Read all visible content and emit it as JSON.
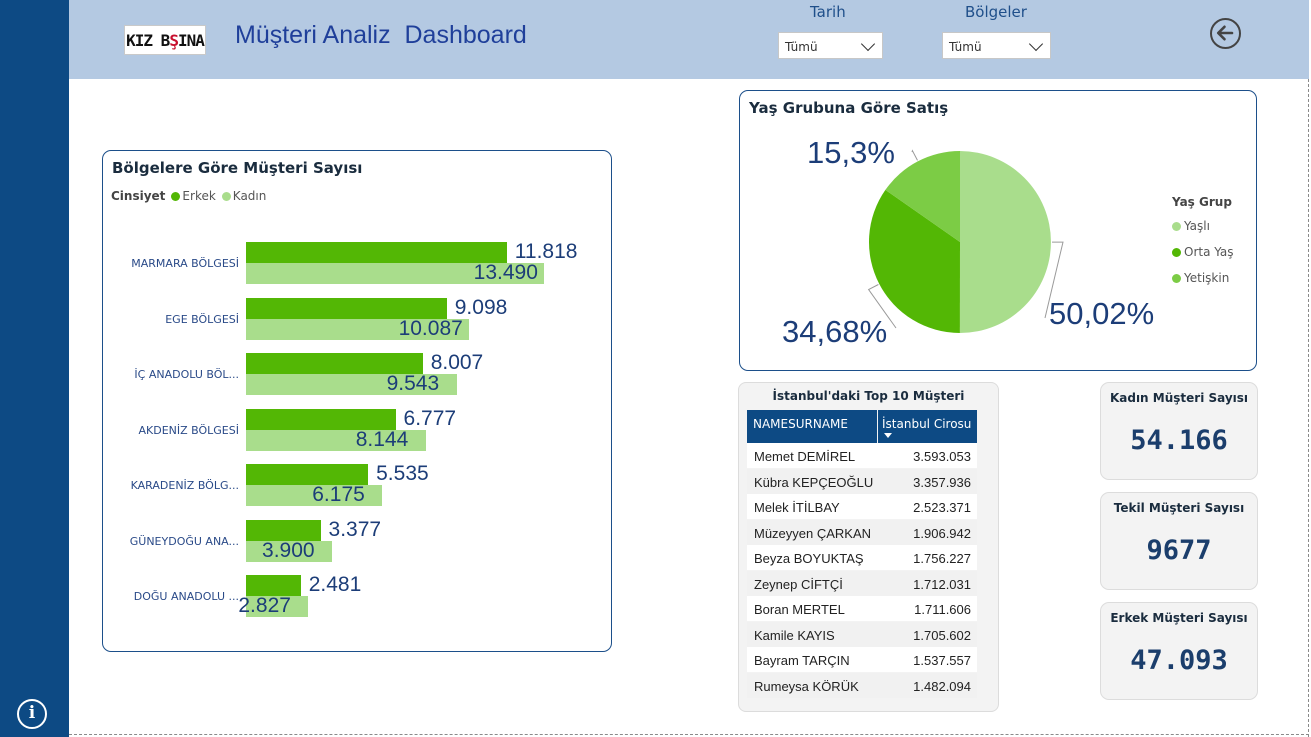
{
  "header": {
    "logo_part1": "KIZ B",
    "logo_part2": "Ş",
    "logo_part3": "INA",
    "title": "Müşteri Analiz  Dashboard",
    "slicers": [
      {
        "label": "Tarih",
        "value": "Tümü"
      },
      {
        "label": "Bölgeler",
        "value": "Tümü"
      }
    ],
    "back_icon": "back-arrow-icon",
    "info_icon": "info-icon"
  },
  "bar_panel": {
    "title": "Bölgelere Göre Müşteri Sayısı",
    "legend_title": "Cinsiyet"
  },
  "pie_panel": {
    "title": "Yaş Grubuna Göre Satış",
    "legend_title": "Yaş Grup"
  },
  "chart_data": [
    {
      "type": "bar",
      "orientation": "horizontal",
      "title": "Bölgelere Göre Müşteri Sayısı",
      "legend_title": "Cinsiyet",
      "legend_position": "top-left",
      "categories": [
        "MARMARA BÖLGESİ",
        "EGE BÖLGESİ",
        "İÇ ANADOLU BÖL...",
        "AKDENİZ BÖLGESİ",
        "KARADENİZ BÖLG...",
        "GÜNEYDOĞU ANA...",
        "DOĞU ANADOLU ..."
      ],
      "series": [
        {
          "name": "Erkek",
          "color": "#53b705",
          "values": [
            11818,
            9098,
            8007,
            6777,
            5535,
            3377,
            2481
          ],
          "labels": [
            "11.818",
            "9.098",
            "8.007",
            "6.777",
            "5.535",
            "3.377",
            "2.481"
          ]
        },
        {
          "name": "Kadın",
          "color": "#a9dd8c",
          "values": [
            13490,
            10087,
            9543,
            8144,
            6175,
            3900,
            2827
          ],
          "labels": [
            "13.490",
            "10.087",
            "9.543",
            "8.144",
            "6.175",
            "3.900",
            "2.827"
          ]
        }
      ],
      "xlim": [
        0,
        15000
      ],
      "grid": false
    },
    {
      "type": "pie",
      "title": "Yaş Grubuna Göre Satış",
      "legend_title": "Yaş Grup",
      "legend_position": "right",
      "slices": [
        {
          "name": "Yaşlı",
          "value": 50.02,
          "label": "50,02%",
          "color": "#a9dd8c"
        },
        {
          "name": "Orta Yaş",
          "value": 34.68,
          "label": "34,68%",
          "color": "#53b705"
        },
        {
          "name": "Yetişkin",
          "value": 15.3,
          "label": "15,3%",
          "color": "#7ccc45"
        }
      ]
    }
  ],
  "table": {
    "title": "İstanbul'daki Top 10 Müşteri",
    "columns": [
      "NAMESURNAME",
      "İstanbul Cirosu"
    ],
    "rows": [
      [
        "Memet DEMİREL",
        "3.593.053"
      ],
      [
        "Kübra KEPÇEOĞLU",
        "3.357.936"
      ],
      [
        "Melek İTİLBAY",
        "2.523.371"
      ],
      [
        "Müzeyyen ÇARKAN",
        "1.906.942"
      ],
      [
        "Beyza BOYUKTAŞ",
        "1.756.227"
      ],
      [
        "Zeynep CİFTÇİ",
        "1.712.031"
      ],
      [
        "Boran MERTEL",
        "1.711.606"
      ],
      [
        "Kamile KAYIS",
        "1.705.602"
      ],
      [
        "Bayram TARÇIN",
        "1.537.557"
      ],
      [
        "Rumeysa KÖRÜK",
        "1.482.094"
      ]
    ]
  },
  "kpis": [
    {
      "title": "Kadın Müşteri Sayısı",
      "value": "54.166"
    },
    {
      "title": "Tekil Müşteri Sayısı",
      "value": "9677"
    },
    {
      "title": "Erkek Müşteri Sayısı",
      "value": "47.093"
    }
  ]
}
